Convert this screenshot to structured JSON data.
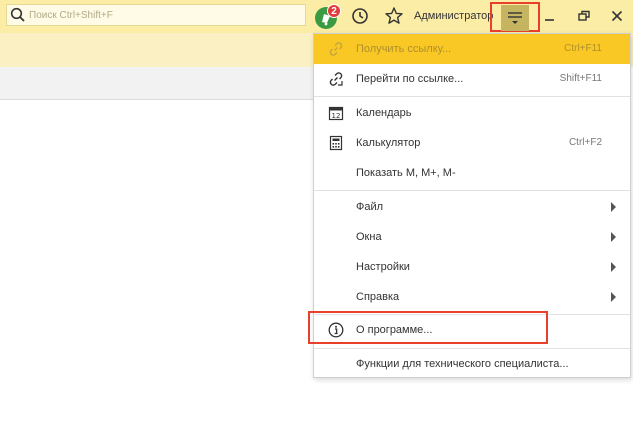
{
  "search": {
    "placeholder": "Поиск Ctrl+Shift+F"
  },
  "header": {
    "notification_count": "2",
    "user_name": "Администратор"
  },
  "menu": {
    "items": [
      {
        "label": "Получить ссылку...",
        "shortcut": "Ctrl+F11",
        "icon": "link-icon",
        "disabled": true
      },
      {
        "label": "Перейти по ссылке...",
        "shortcut": "Shift+F11",
        "icon": "go-to-link-icon"
      },
      {
        "label": "Календарь",
        "shortcut": "",
        "icon": "calendar-icon",
        "icon_text": "12"
      },
      {
        "label": "Калькулятор",
        "shortcut": "Ctrl+F2",
        "icon": "calculator-icon"
      },
      {
        "label": "Показать М, М+, М-",
        "shortcut": ""
      },
      {
        "label": "Файл",
        "submenu": true
      },
      {
        "label": "Окна",
        "submenu": true
      },
      {
        "label": "Настройки",
        "submenu": true
      },
      {
        "label": "Справка",
        "submenu": true
      },
      {
        "label": "О программе...",
        "icon": "info-icon",
        "highlighted": true
      },
      {
        "label": "Функции для технического специалиста..."
      }
    ]
  },
  "colors": {
    "topbar": "#fbeca6",
    "subbar": "#fbf0c3",
    "disabled_item": "#f9c824",
    "highlight_border": "#e8402a",
    "menu_button_active": "#c6b560"
  }
}
